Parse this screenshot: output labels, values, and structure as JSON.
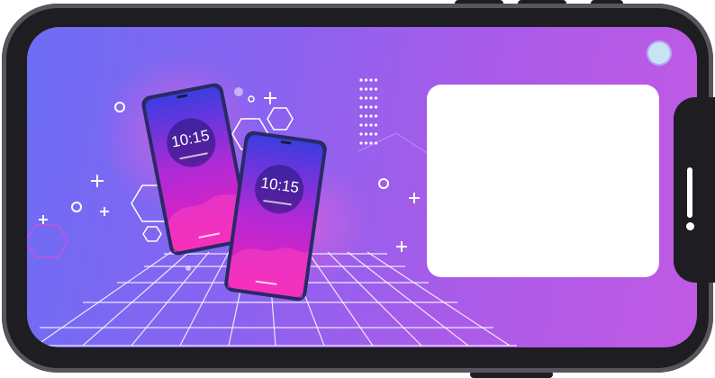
{
  "illustration": {
    "phones": [
      {
        "clock_text": "10:15"
      },
      {
        "clock_text": "10:15"
      }
    ]
  },
  "colors": {
    "screen_gradient_start": "#6d6df5",
    "screen_gradient_end": "#c15ae4",
    "frame": "#1e1e22",
    "card": "#ffffff"
  },
  "icons": [
    "plus-icon",
    "ring-icon",
    "hexagon-icon",
    "dot-grid-icon"
  ]
}
